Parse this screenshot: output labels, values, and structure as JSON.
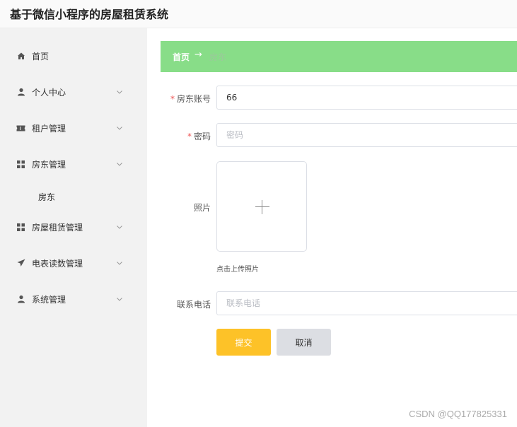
{
  "app": {
    "title": "基于微信小程序的房屋租赁系统"
  },
  "sidebar": {
    "items": [
      {
        "label": "首页",
        "icon": "home-icon"
      },
      {
        "label": "个人中心",
        "icon": "user-icon"
      },
      {
        "label": "租户管理",
        "icon": "ticket-icon"
      },
      {
        "label": "房东管理",
        "icon": "grid-icon"
      },
      {
        "label": "房屋租赁管理",
        "icon": "grid-icon"
      },
      {
        "label": "电表读数管理",
        "icon": "send-icon"
      },
      {
        "label": "系统管理",
        "icon": "user-icon"
      }
    ],
    "sub_item": {
      "label": "房东"
    }
  },
  "breadcrumb": {
    "home": "首页",
    "separator": "→",
    "current": "房东"
  },
  "form": {
    "account_label": "房东账号",
    "account_value": "66",
    "password_label": "密码",
    "password_placeholder": "密码",
    "photo_label": "照片",
    "photo_hint": "点击上传照片",
    "phone_label": "联系电话",
    "phone_placeholder": "联系电话",
    "required_mark": "*",
    "submit_label": "提交",
    "cancel_label": "取消"
  },
  "watermark": "CSDN @QQ177825331",
  "colors": {
    "breadcrumb_bg": "#88dd88",
    "submit_bg": "#fdc228",
    "cancel_bg": "#dcdee3",
    "required": "#ee5555"
  }
}
